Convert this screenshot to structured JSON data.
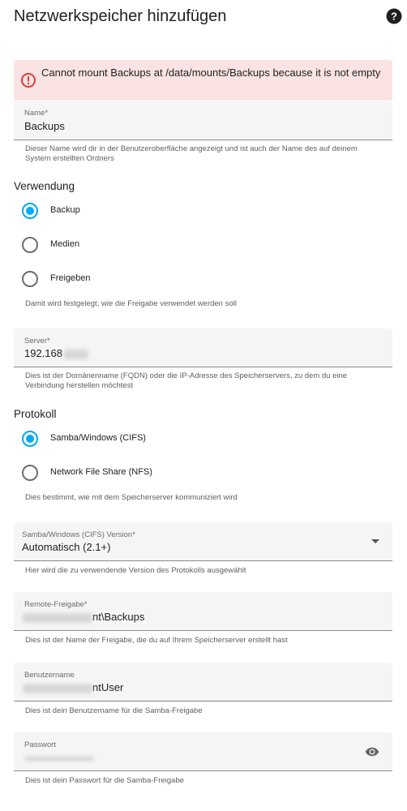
{
  "header": {
    "title": "Netzwerkspeicher hinzufügen",
    "help_icon": "help-circle-icon"
  },
  "alert": {
    "icon": "alert-circle-icon",
    "color": "#e53935",
    "background": "#fbe3e3",
    "text": "Cannot mount Backups at /data/mounts/Backups because it is not empty"
  },
  "name_field": {
    "label": "Name*",
    "value": "Backups",
    "helper": "Dieser Name wird dir in der Benutzeroberfläche angezeigt und ist auch der Name des auf deinem System erstellten Ordners"
  },
  "usage": {
    "title": "Verwendung",
    "options": [
      {
        "label": "Backup",
        "checked": true
      },
      {
        "label": "Medien",
        "checked": false
      },
      {
        "label": "Freigeben",
        "checked": false
      }
    ],
    "helper": "Damit wird festgelegt, wie die Freigabe verwendet werden soll"
  },
  "server_field": {
    "label": "Server*",
    "value": "192.168",
    "helper": "Dies ist der Domänenname (FQDN) oder die IP-Adresse des Speicherservers, zu dem du eine Verbindung herstellen möchtest"
  },
  "protocol": {
    "title": "Protokoll",
    "options": [
      {
        "label": "Samba/Windows (CIFS)",
        "checked": true
      },
      {
        "label": "Network File Share (NFS)",
        "checked": false
      }
    ],
    "helper": "Dies bestimmt, wie mit dem Speicherserver kommuniziert wird"
  },
  "version_field": {
    "label": "Samba/Windows (CIFS) Version*",
    "value": "Automatisch (2.1+)",
    "helper": "Hier wird die zu verwendende Version des Protokolls ausgewählt",
    "icon": "dropdown-arrow-icon"
  },
  "share_field": {
    "label": "Remote-Freigabe*",
    "value": "nt\\Backups",
    "helper": "Dies ist der Name der Freigabe, die du auf Ihrem Speicherserver erstellt hast"
  },
  "username_field": {
    "label": "Benutzername",
    "value": "ntUser",
    "helper": "Dies ist dein Benutzername für die Samba-Freigabe"
  },
  "password_field": {
    "label": "Passwort",
    "helper": "Dies ist dein Passwort für die Samba-Freigabe",
    "icon": "eye-icon"
  },
  "colors": {
    "accent": "#03a9f4",
    "error": "#e53935"
  }
}
